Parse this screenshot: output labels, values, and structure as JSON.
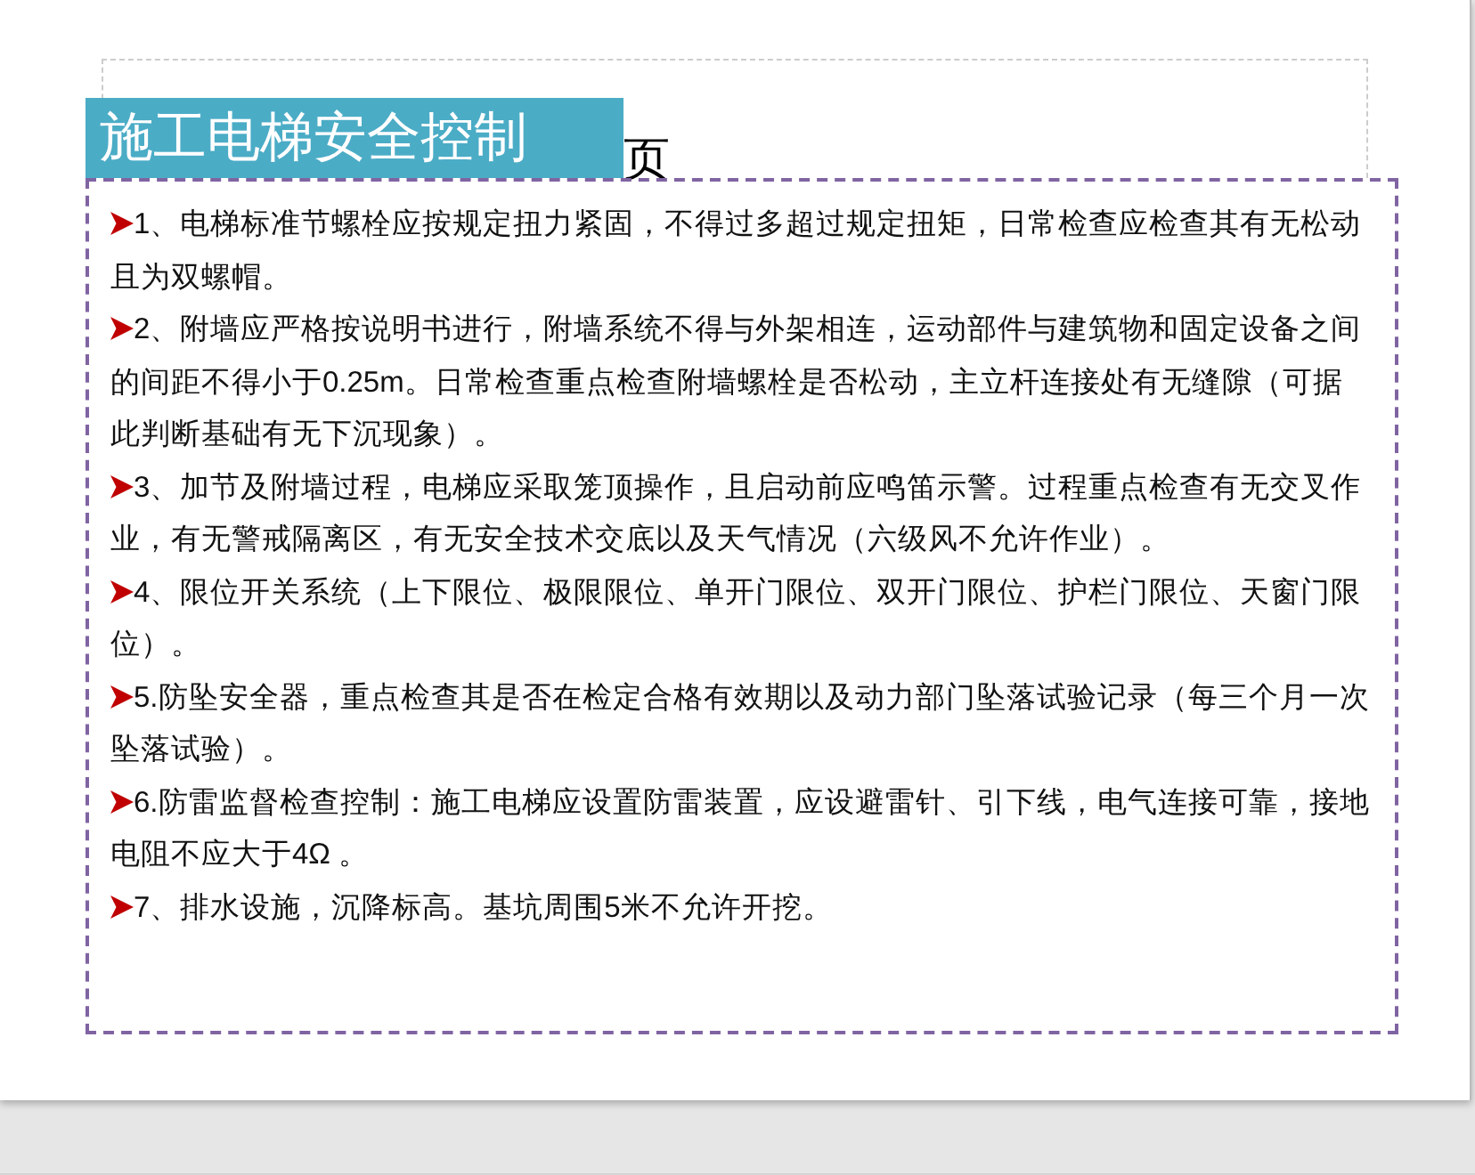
{
  "slide": {
    "title": "施工电梯安全控制",
    "hidden_title_remnant": "页",
    "items": [
      {
        "text": "1、电梯标准节螺栓应按规定扭力紧固，不得过多超过规定扭矩，日常检查应检查其有无松动且为双螺帽。"
      },
      {
        "text": "2、附墙应严格按说明书进行，附墙系统不得与外架相连，运动部件与建筑物和固定设备之间的间距不得小于0.25m。日常检查重点检查附墙螺栓是否松动，主立杆连接处有无缝隙（可据此判断基础有无下沉现象）。"
      },
      {
        "text": "3、加节及附墙过程，电梯应采取笼顶操作，且启动前应鸣笛示警。过程重点检查有无交叉作业，有无警戒隔离区，有无安全技术交底以及天气情况（六级风不允许作业）。"
      },
      {
        "text": "4、限位开关系统（上下限位、极限限位、单开门限位、双开门限位、护栏门限位、天窗门限位）。"
      },
      {
        "text": "5.防坠安全器，重点检查其是否在检定合格有效期以及动力部门坠落试验记录（每三个月一次坠落试验）。"
      },
      {
        "text": "6.防雷监督检查控制：施工电梯应设置防雷装置，应设避雷针、引下线，电气连接可靠，接地电阻不应大于4Ω 。"
      },
      {
        "text": "7、排水设施，沉降标高。基坑周围5米不允许开挖。"
      }
    ]
  }
}
